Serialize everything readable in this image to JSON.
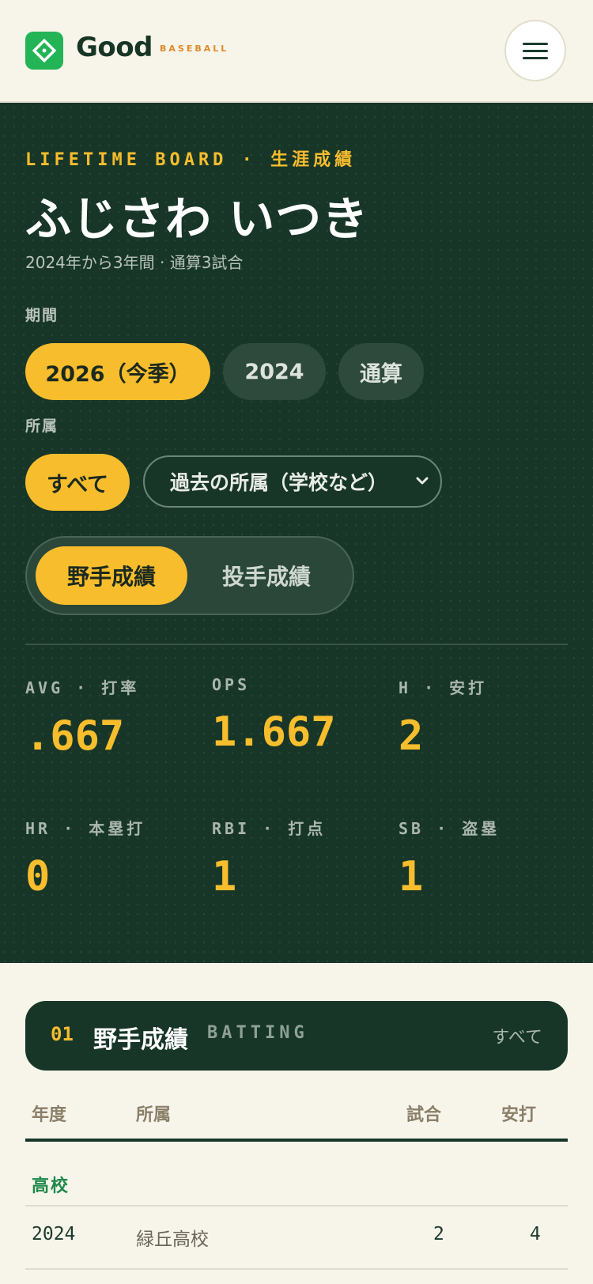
{
  "header": {
    "logo_text": "Good",
    "logo_sub": "BASEBALL"
  },
  "hero": {
    "eyebrow": "LIFETIME BOARD · 生涯成績",
    "player_name": "ふじさわ いつき",
    "subtitle": "2024年から3年間 · 通算3試合",
    "period_label": "期間",
    "period_options": [
      "2026（今季）",
      "2024",
      "通算"
    ],
    "period_selected": "2026（今季）",
    "affiliation_label": "所属",
    "affiliation_all": "すべて",
    "affiliation_select": "過去の所属（学校など）",
    "mode_tabs": [
      "野手成績",
      "投手成績"
    ],
    "mode_selected": "野手成績",
    "stats": [
      {
        "label": "AVG · 打率",
        "value": ".667"
      },
      {
        "label": "OPS",
        "value": "1.667"
      },
      {
        "label": "H · 安打",
        "value": "2"
      },
      {
        "label": "HR · 本塁打",
        "value": "0"
      },
      {
        "label": "RBI · 打点",
        "value": "1"
      },
      {
        "label": "SB · 盗塁",
        "value": "1"
      }
    ]
  },
  "batting_section": {
    "number": "01",
    "title": "野手成績",
    "title_en": "BATTING",
    "filter": "すべて",
    "columns": [
      "年度",
      "所属",
      "試合",
      "安打"
    ],
    "groups": [
      {
        "label": "高校",
        "rows": [
          {
            "year": "2024",
            "affiliation": "緑丘高校",
            "games": "2",
            "hits": "4"
          }
        ]
      }
    ]
  },
  "colors": {
    "accent": "#f8bd2c",
    "hero_bg": "#173628",
    "page_bg": "#f7f4ea",
    "brand_green": "#22b455"
  }
}
